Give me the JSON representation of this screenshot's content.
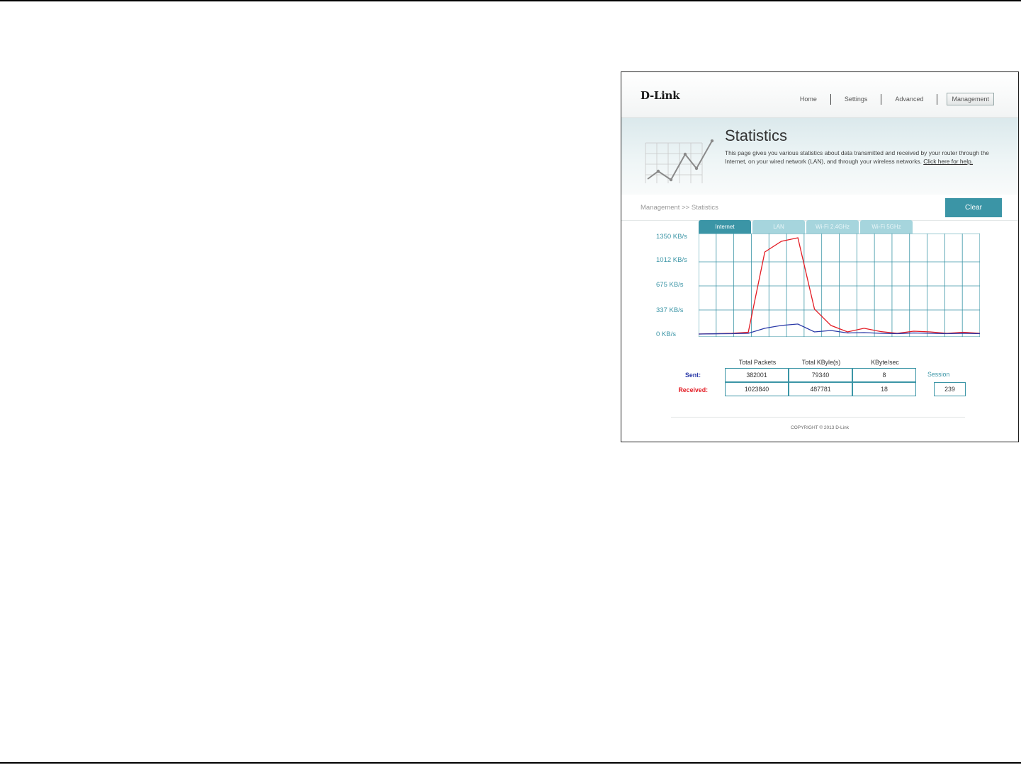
{
  "header": {
    "logo": "D-Link",
    "nav": [
      {
        "label": "Home",
        "active": false
      },
      {
        "label": "Settings",
        "active": false
      },
      {
        "label": "Advanced",
        "active": false
      },
      {
        "label": "Management",
        "active": true
      }
    ]
  },
  "banner": {
    "title": "Statistics",
    "description": "This page gives you various statistics about data transmitted and received by your router through the Internet, on your wired network (LAN), and through your wireless networks.",
    "help_link": "Click here for help."
  },
  "breadcrumb": "Management >> Statistics",
  "clear_button": "Clear",
  "tabs": [
    {
      "label": "Internet",
      "active": true
    },
    {
      "label": "LAN",
      "active": false
    },
    {
      "label": "Wi-Fi 2.4GHz",
      "active": false
    },
    {
      "label": "Wi-Fi 5GHz",
      "active": false
    }
  ],
  "chart_data": {
    "type": "line",
    "y_ticks": [
      "1350 KB/s",
      "1012 KB/s",
      "675 KB/s",
      "337 KB/s",
      "0 KB/s"
    ],
    "ylim": [
      0,
      1350
    ],
    "grid": true,
    "series": [
      {
        "color": "#e31b23",
        "values": [
          0,
          5,
          10,
          25,
          1150,
          1300,
          1350,
          350,
          120,
          30,
          80,
          35,
          10,
          40,
          30,
          10,
          25,
          10
        ]
      },
      {
        "color": "#2b3aa8",
        "values": [
          0,
          3,
          5,
          10,
          80,
          120,
          140,
          30,
          50,
          15,
          20,
          10,
          5,
          15,
          10,
          5,
          10,
          5
        ]
      }
    ]
  },
  "stats": {
    "headers": [
      "Total Packets",
      "Total KByle(s)",
      "KByte/sec"
    ],
    "rows": [
      {
        "label": "Sent:",
        "color": "#2b3aa8",
        "values": [
          "382001",
          "79340",
          "8"
        ]
      },
      {
        "label": "Received:",
        "color": "#e31b23",
        "values": [
          "1023840",
          "487781",
          "18"
        ]
      }
    ],
    "session_label": "Session",
    "session_value": "239"
  },
  "footer": {
    "copyright": "COPYRIGHT © 2013 D-Link"
  }
}
